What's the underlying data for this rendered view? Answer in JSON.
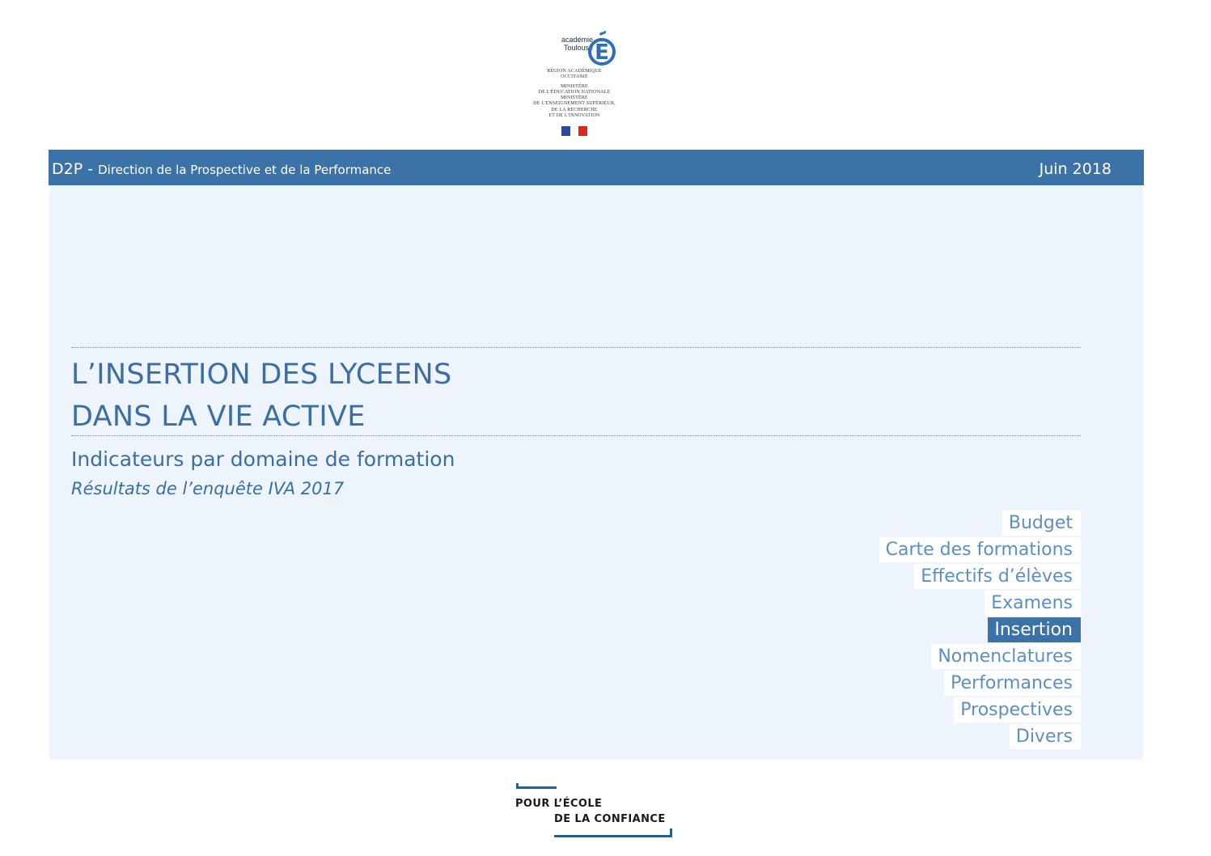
{
  "logo_top": {
    "academy_line1": "académie",
    "academy_line2": "Toulouse",
    "region": [
      "RÉGION ACADÉMIQUE",
      "OCCITANIE"
    ],
    "ministries": [
      "MINISTÈRE",
      "DE L'ÉDUCATION NATIONALE",
      "MINISTÈRE",
      "DE L'ENSEIGNEMENT SUPÉRIEUR,",
      "DE LA RECHERCHE",
      "ET DE L'INNOVATION"
    ],
    "emblem_icon": "letter-e-badge-icon",
    "flag_icon": "french-flag-icon"
  },
  "header": {
    "brand": "D2P -",
    "brand_sub": "Direction de la Prospective et de la Performance",
    "date": "Juin 2018",
    "color": "#3b72a8"
  },
  "main": {
    "title_line1": "L’INSERTION DES LYCEENS",
    "title_line2": "DANS LA VIE ACTIVE",
    "subtitle": "Indicateurs par domaine de formation",
    "subtitle_italic": "Résultats de l’enquête IVA 2017",
    "background": "#eef4fc"
  },
  "menu": {
    "items": [
      {
        "label": "Budget",
        "active": false
      },
      {
        "label": "Carte des formations",
        "active": false
      },
      {
        "label": "Effectifs d’élèves",
        "active": false
      },
      {
        "label": "Examens",
        "active": false
      },
      {
        "label": "Insertion",
        "active": true
      },
      {
        "label": "Nomenclatures",
        "active": false
      },
      {
        "label": "Performances",
        "active": false
      },
      {
        "label": "Prospectives",
        "active": false
      },
      {
        "label": "Divers",
        "active": false
      }
    ]
  },
  "logo_bottom": {
    "line1": "POUR L’ÉCOLE",
    "line2": "DE LA CONFIANCE"
  }
}
